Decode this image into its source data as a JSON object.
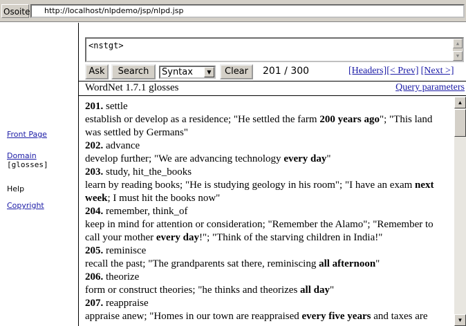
{
  "browser": {
    "address_label": "Osoite",
    "url": "http://localhost/nlpdemo/jsp/nlpd.jsp"
  },
  "sidebar": {
    "front_page": "Front Page",
    "domain": "Domain",
    "domain_sub": "[glosses]",
    "help": "Help",
    "copyright": "Copyright"
  },
  "query": {
    "text": "<nstgt>",
    "ask_label": "Ask",
    "search_label": "Search",
    "mode_selected": "Syntax",
    "clear_label": "Clear",
    "counter": "201 / 300",
    "headers_link": "[Headers]",
    "prev_link": "[< Prev]",
    "next_link": "[Next >]"
  },
  "results": {
    "title": "WordNet 1.7.1 glosses",
    "query_params_link": "Query parameters",
    "entries": [
      {
        "num": "201.",
        "word": "settle",
        "gloss": [
          {
            "t": "establish or develop as a residence; \"He settled the farm "
          },
          {
            "t": "200 years ago",
            "b": true
          },
          {
            "t": "\"; \"This land was settled by Germans\""
          }
        ]
      },
      {
        "num": "202.",
        "word": "advance",
        "gloss": [
          {
            "t": "develop further; \"We are advancing technology "
          },
          {
            "t": "every day",
            "b": true
          },
          {
            "t": "\""
          }
        ]
      },
      {
        "num": "203.",
        "word": "study, hit_the_books",
        "gloss": [
          {
            "t": "learn by reading books; \"He is studying geology in his room\"; \"I have an exam "
          },
          {
            "t": "next week",
            "b": true
          },
          {
            "t": "; I must hit the books now\""
          }
        ]
      },
      {
        "num": "204.",
        "word": "remember, think_of",
        "gloss": [
          {
            "t": "keep in mind for attention or consideration; \"Remember the Alamo\"; \"Remember to call your mother "
          },
          {
            "t": "every day",
            "b": true
          },
          {
            "t": "!\"; \"Think of the starving children in India!\""
          }
        ]
      },
      {
        "num": "205.",
        "word": "reminisce",
        "gloss": [
          {
            "t": "recall the past; \"The grandparents sat there, reminiscing "
          },
          {
            "t": "all afternoon",
            "b": true
          },
          {
            "t": "\""
          }
        ]
      },
      {
        "num": "206.",
        "word": "theorize",
        "gloss": [
          {
            "t": "form or construct theories; \"he thinks and theorizes "
          },
          {
            "t": "all day",
            "b": true
          },
          {
            "t": "\""
          }
        ]
      },
      {
        "num": "207.",
        "word": "reappraise",
        "gloss": [
          {
            "t": "appraise anew; \"Homes in our town are reappraised "
          },
          {
            "t": "every five years",
            "b": true
          },
          {
            "t": " and taxes are"
          }
        ]
      }
    ]
  }
}
